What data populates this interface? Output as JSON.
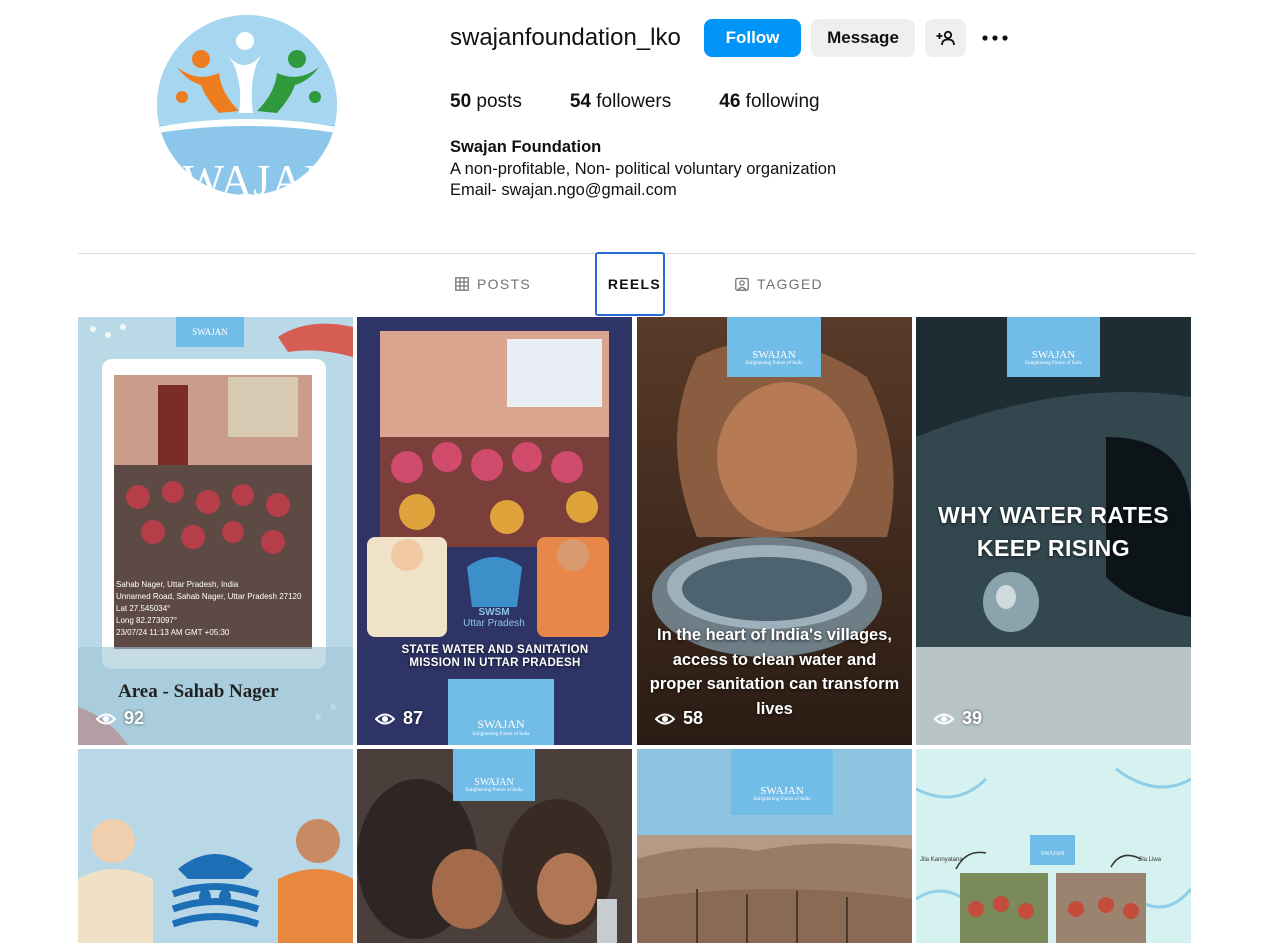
{
  "profile": {
    "username": "swajanfoundation_lko",
    "avatar_text": "SWAJAN",
    "follow_label": "Follow",
    "message_label": "Message",
    "stats": {
      "posts_count": "50",
      "posts_label": "posts",
      "followers_count": "54",
      "followers_label": "followers",
      "following_count": "46",
      "following_label": "following"
    },
    "bio": {
      "name": "Swajan Foundation",
      "line1": "A non-profitable, Non- political voluntary organization",
      "line2": "Email- swajan.ngo@gmail.com"
    }
  },
  "tabs": [
    {
      "label": "POSTS",
      "icon": "grid-icon",
      "active": false
    },
    {
      "label": "REELS",
      "icon": "reels-icon",
      "active": true
    },
    {
      "label": "TAGGED",
      "icon": "tagged-icon",
      "active": false
    }
  ],
  "reels": [
    {
      "views": "92",
      "caption": "Area - Sahab Nager",
      "logo": "SWAJAN",
      "photo_text": [
        "Sahab Nager, Uttar Pradesh, India",
        "Unnamed Road, Sahab Nager, Uttar Pradesh 27120",
        "Lat 27.545034°",
        "Long 82.273097°",
        "23/07/24 11:13 AM GMT +05:30"
      ]
    },
    {
      "views": "87",
      "caption": "STATE WATER AND SANITATION MISSION IN UTTAR PRADESH",
      "logo": "SWAJAN",
      "logo_sub": "Enlightening Future of India",
      "emblem": "SWSM",
      "emblem_sub": "Uttar Pradesh"
    },
    {
      "views": "58",
      "caption": "In the heart of India's villages, access to clean water and proper sanitation can transform lives",
      "logo": "SWAJAN",
      "logo_sub": "Enlightening Future of India"
    },
    {
      "views": "39",
      "caption": "WHY WATER RATES KEEP RISING",
      "logo": "SWAJAN",
      "logo_sub": "Enlightening Future of India"
    },
    {
      "views": "",
      "caption": "",
      "logo": ""
    },
    {
      "views": "",
      "caption": "",
      "logo": "SWAJAN",
      "logo_sub": "Enlightening Future of India"
    },
    {
      "views": "",
      "caption": "",
      "logo": "SWAJAN",
      "logo_sub": "Enlightening Future of India"
    },
    {
      "views": "",
      "caption": "",
      "logo": "SWAJAN",
      "arrow_left": "Jila Kannyatana",
      "arrow_right": "Jila Liwa"
    }
  ],
  "colors": {
    "follow_blue": "#0095f6",
    "button_gray": "#efefef",
    "active_tab_outline": "#2a6ad6",
    "brand_orange": "#ee7d21",
    "brand_green": "#2e9a3c",
    "brand_sky": "#72bde8"
  }
}
